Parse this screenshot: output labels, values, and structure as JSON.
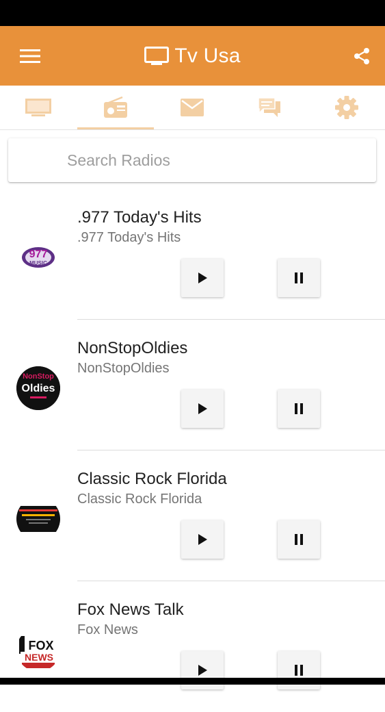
{
  "app_bar": {
    "title": "Tv Usa",
    "color": "#e8913a",
    "menu_icon": "hamburger-menu-icon",
    "share_icon": "share-icon"
  },
  "tabs": [
    {
      "icon": "tv-icon",
      "active": false
    },
    {
      "icon": "radio-icon",
      "active": true
    },
    {
      "icon": "mail-icon",
      "active": false
    },
    {
      "icon": "chat-icon",
      "active": false
    },
    {
      "icon": "settings-gear-icon",
      "active": false
    }
  ],
  "search": {
    "placeholder": "Search Radios",
    "value": ""
  },
  "radios": [
    {
      "name": ".977 Today's Hits",
      "subtitle": ".977 Today's Hits",
      "logo_text": "977",
      "logo_subtext": "MUSIC"
    },
    {
      "name": "NonStopOldies",
      "subtitle": "NonStopOldies",
      "logo_text": "Oldies",
      "logo_subtext": "NonStop"
    },
    {
      "name": "Classic Rock Florida",
      "subtitle": "Classic Rock Florida",
      "logo_text": "",
      "logo_subtext": ""
    },
    {
      "name": "Fox News Talk",
      "subtitle": "Fox News",
      "logo_text": "FOX",
      "logo_subtext": "NEWS"
    }
  ]
}
